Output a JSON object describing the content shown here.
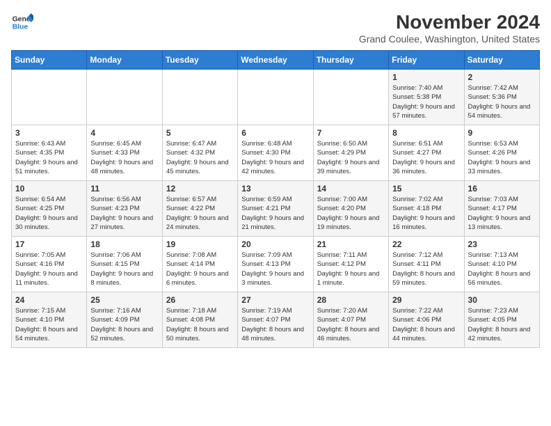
{
  "logo": {
    "line1": "General",
    "line2": "Blue"
  },
  "title": "November 2024",
  "location": "Grand Coulee, Washington, United States",
  "days_header": [
    "Sunday",
    "Monday",
    "Tuesday",
    "Wednesday",
    "Thursday",
    "Friday",
    "Saturday"
  ],
  "weeks": [
    [
      {
        "day": "",
        "info": ""
      },
      {
        "day": "",
        "info": ""
      },
      {
        "day": "",
        "info": ""
      },
      {
        "day": "",
        "info": ""
      },
      {
        "day": "",
        "info": ""
      },
      {
        "day": "1",
        "info": "Sunrise: 7:40 AM\nSunset: 5:38 PM\nDaylight: 9 hours and 57 minutes."
      },
      {
        "day": "2",
        "info": "Sunrise: 7:42 AM\nSunset: 5:36 PM\nDaylight: 9 hours and 54 minutes."
      }
    ],
    [
      {
        "day": "3",
        "info": "Sunrise: 6:43 AM\nSunset: 4:35 PM\nDaylight: 9 hours and 51 minutes."
      },
      {
        "day": "4",
        "info": "Sunrise: 6:45 AM\nSunset: 4:33 PM\nDaylight: 9 hours and 48 minutes."
      },
      {
        "day": "5",
        "info": "Sunrise: 6:47 AM\nSunset: 4:32 PM\nDaylight: 9 hours and 45 minutes."
      },
      {
        "day": "6",
        "info": "Sunrise: 6:48 AM\nSunset: 4:30 PM\nDaylight: 9 hours and 42 minutes."
      },
      {
        "day": "7",
        "info": "Sunrise: 6:50 AM\nSunset: 4:29 PM\nDaylight: 9 hours and 39 minutes."
      },
      {
        "day": "8",
        "info": "Sunrise: 6:51 AM\nSunset: 4:27 PM\nDaylight: 9 hours and 36 minutes."
      },
      {
        "day": "9",
        "info": "Sunrise: 6:53 AM\nSunset: 4:26 PM\nDaylight: 9 hours and 33 minutes."
      }
    ],
    [
      {
        "day": "10",
        "info": "Sunrise: 6:54 AM\nSunset: 4:25 PM\nDaylight: 9 hours and 30 minutes."
      },
      {
        "day": "11",
        "info": "Sunrise: 6:56 AM\nSunset: 4:23 PM\nDaylight: 9 hours and 27 minutes."
      },
      {
        "day": "12",
        "info": "Sunrise: 6:57 AM\nSunset: 4:22 PM\nDaylight: 9 hours and 24 minutes."
      },
      {
        "day": "13",
        "info": "Sunrise: 6:59 AM\nSunset: 4:21 PM\nDaylight: 9 hours and 21 minutes."
      },
      {
        "day": "14",
        "info": "Sunrise: 7:00 AM\nSunset: 4:20 PM\nDaylight: 9 hours and 19 minutes."
      },
      {
        "day": "15",
        "info": "Sunrise: 7:02 AM\nSunset: 4:18 PM\nDaylight: 9 hours and 16 minutes."
      },
      {
        "day": "16",
        "info": "Sunrise: 7:03 AM\nSunset: 4:17 PM\nDaylight: 9 hours and 13 minutes."
      }
    ],
    [
      {
        "day": "17",
        "info": "Sunrise: 7:05 AM\nSunset: 4:16 PM\nDaylight: 9 hours and 11 minutes."
      },
      {
        "day": "18",
        "info": "Sunrise: 7:06 AM\nSunset: 4:15 PM\nDaylight: 9 hours and 8 minutes."
      },
      {
        "day": "19",
        "info": "Sunrise: 7:08 AM\nSunset: 4:14 PM\nDaylight: 9 hours and 6 minutes."
      },
      {
        "day": "20",
        "info": "Sunrise: 7:09 AM\nSunset: 4:13 PM\nDaylight: 9 hours and 3 minutes."
      },
      {
        "day": "21",
        "info": "Sunrise: 7:11 AM\nSunset: 4:12 PM\nDaylight: 9 hours and 1 minute."
      },
      {
        "day": "22",
        "info": "Sunrise: 7:12 AM\nSunset: 4:11 PM\nDaylight: 8 hours and 59 minutes."
      },
      {
        "day": "23",
        "info": "Sunrise: 7:13 AM\nSunset: 4:10 PM\nDaylight: 8 hours and 56 minutes."
      }
    ],
    [
      {
        "day": "24",
        "info": "Sunrise: 7:15 AM\nSunset: 4:10 PM\nDaylight: 8 hours and 54 minutes."
      },
      {
        "day": "25",
        "info": "Sunrise: 7:16 AM\nSunset: 4:09 PM\nDaylight: 8 hours and 52 minutes."
      },
      {
        "day": "26",
        "info": "Sunrise: 7:18 AM\nSunset: 4:08 PM\nDaylight: 8 hours and 50 minutes."
      },
      {
        "day": "27",
        "info": "Sunrise: 7:19 AM\nSunset: 4:07 PM\nDaylight: 8 hours and 48 minutes."
      },
      {
        "day": "28",
        "info": "Sunrise: 7:20 AM\nSunset: 4:07 PM\nDaylight: 8 hours and 46 minutes."
      },
      {
        "day": "29",
        "info": "Sunrise: 7:22 AM\nSunset: 4:06 PM\nDaylight: 8 hours and 44 minutes."
      },
      {
        "day": "30",
        "info": "Sunrise: 7:23 AM\nSunset: 4:05 PM\nDaylight: 8 hours and 42 minutes."
      }
    ]
  ]
}
